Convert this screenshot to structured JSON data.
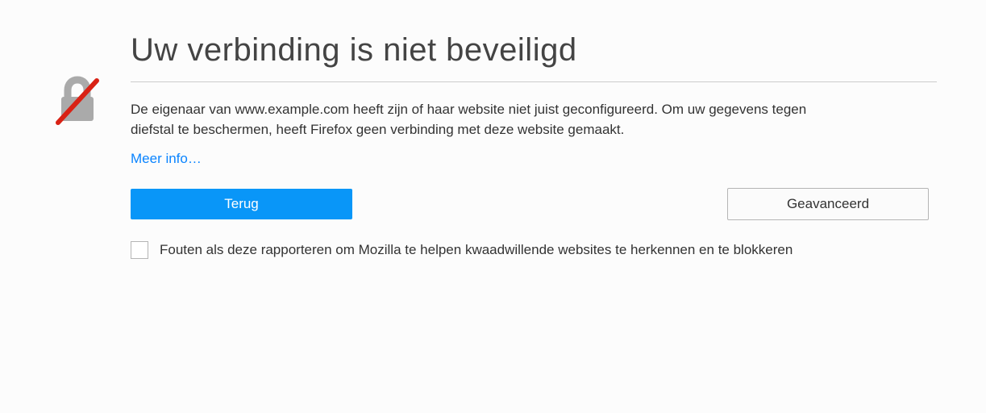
{
  "title": "Uw verbinding is niet beveiligd",
  "body": "De eigenaar van www.example.com heeft zijn of haar website niet juist geconfigureerd. Om uw gegevens tegen diefstal te beschermen, heeft Firefox geen verbinding met deze website gemaakt.",
  "more_info_label": "Meer info…",
  "buttons": {
    "back": "Terug",
    "advanced": "Geavanceerd"
  },
  "checkbox_label": "Fouten als deze rapporteren om Mozilla te helpen kwaadwillende websites te herkennen en te blokkeren"
}
